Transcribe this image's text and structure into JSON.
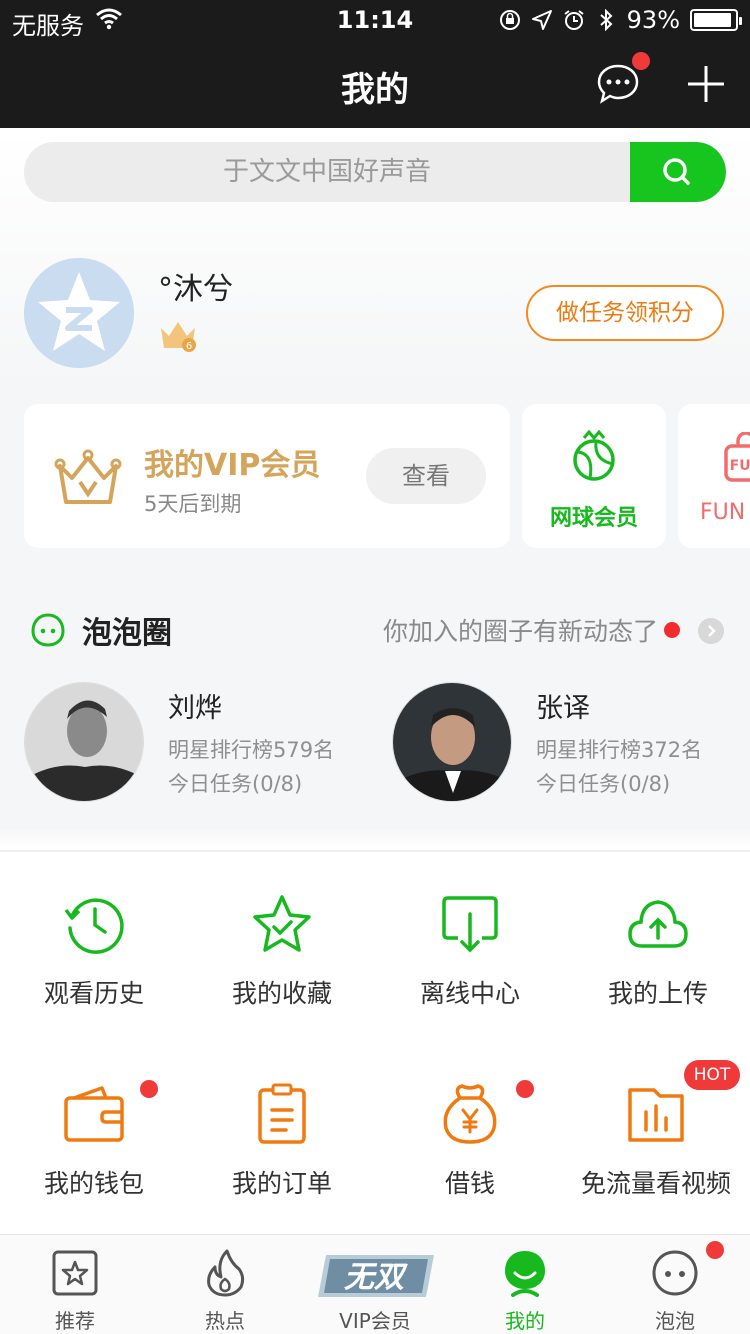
{
  "status_bar": {
    "carrier": "无服务",
    "time": "11:14",
    "battery": "93%",
    "battery_level": 0.93
  },
  "nav": {
    "title": "我的"
  },
  "search": {
    "placeholder": "于文文中国好声音"
  },
  "profile": {
    "username": "°沐兮",
    "level": "6",
    "task_button": "做任务领积分"
  },
  "vip_card": {
    "title": "我的VIP会员",
    "subtitle": "5天后到期",
    "view_button": "查看"
  },
  "member_cards": [
    {
      "label": "网球会员",
      "color": "#17b91f"
    },
    {
      "label": "FUN",
      "color": "#f26c6c"
    }
  ],
  "bubble_circle": {
    "title": "泡泡圈",
    "note": "你加入的圈子有新动态了",
    "stars": [
      {
        "name": "刘烨",
        "rank": "明星排行榜579名",
        "task": "今日任务(0/8)"
      },
      {
        "name": "张译",
        "rank": "明星排行榜372名",
        "task": "今日任务(0/8)"
      }
    ]
  },
  "grid": [
    {
      "label": "观看历史",
      "icon": "history-icon"
    },
    {
      "label": "我的收藏",
      "icon": "favorite-star-icon"
    },
    {
      "label": "离线中心",
      "icon": "download-icon"
    },
    {
      "label": "我的上传",
      "icon": "upload-cloud-icon"
    },
    {
      "label": "我的钱包",
      "icon": "wallet-icon",
      "dot": true
    },
    {
      "label": "我的订单",
      "icon": "order-clipboard-icon"
    },
    {
      "label": "借钱",
      "icon": "money-bag-icon",
      "dot": true
    },
    {
      "label": "免流量看视频",
      "icon": "free-data-video-icon",
      "badge": "HOT"
    }
  ],
  "tabbar": [
    {
      "label": "推荐",
      "icon": "star-square-icon"
    },
    {
      "label": "热点",
      "icon": "flame-icon"
    },
    {
      "label": "VIP会员",
      "icon": "wushuang-logo",
      "logo_text": "无双"
    },
    {
      "label": "我的",
      "icon": "me-icon",
      "active": true
    },
    {
      "label": "泡泡",
      "icon": "bubble-face-icon",
      "dot": true
    }
  ],
  "colors": {
    "accent_green": "#17c51f",
    "orange": "#f07a10",
    "gold": "#d4a45a",
    "red_dot": "#f03a3a",
    "topbar": "#1b1b1b"
  }
}
